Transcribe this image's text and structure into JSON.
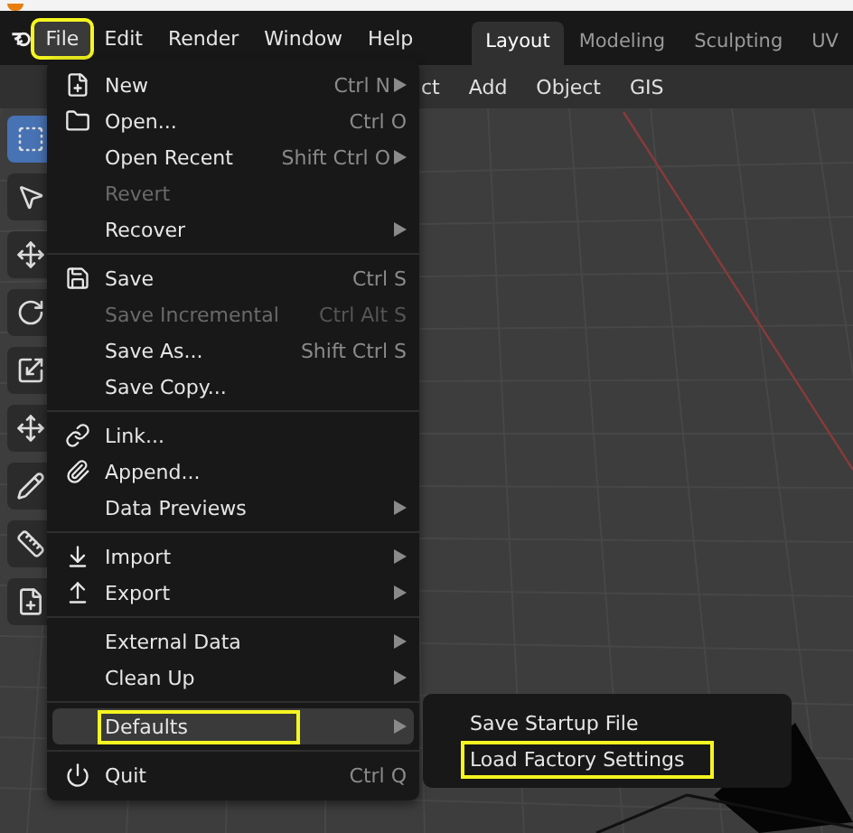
{
  "menubar": {
    "items": [
      {
        "label": "File",
        "selected": true,
        "annotated": true
      },
      {
        "label": "Edit",
        "selected": false,
        "annotated": false
      },
      {
        "label": "Render",
        "selected": false,
        "annotated": false
      },
      {
        "label": "Window",
        "selected": false,
        "annotated": false
      },
      {
        "label": "Help",
        "selected": false,
        "annotated": false
      }
    ]
  },
  "workspace_tabs": [
    {
      "label": "Layout",
      "selected": true
    },
    {
      "label": "Modeling",
      "selected": false
    },
    {
      "label": "Sculpting",
      "selected": false
    },
    {
      "label": "UV",
      "selected": false
    }
  ],
  "viewport_header": {
    "items": [
      "ct",
      "Add",
      "Object",
      "GIS"
    ]
  },
  "file_menu": {
    "sections": [
      [
        {
          "label": "New",
          "shortcut": "Ctrl N",
          "submenu": true,
          "disabled": false,
          "selected": false,
          "annotated": false
        },
        {
          "label": "Open...",
          "shortcut": "Ctrl O",
          "submenu": false,
          "disabled": false,
          "selected": false,
          "annotated": false
        },
        {
          "label": "Open Recent",
          "shortcut": "Shift Ctrl O",
          "submenu": true,
          "disabled": false,
          "selected": false,
          "annotated": false
        },
        {
          "label": "Revert",
          "submenu": false,
          "disabled": true,
          "selected": false,
          "annotated": false
        },
        {
          "label": "Recover",
          "submenu": true,
          "disabled": false,
          "selected": false,
          "annotated": false
        }
      ],
      [
        {
          "label": "Save",
          "shortcut": "Ctrl S",
          "submenu": false,
          "disabled": false,
          "selected": false,
          "annotated": false
        },
        {
          "label": "Save Incremental",
          "shortcut": "Ctrl Alt S",
          "submenu": false,
          "disabled": true,
          "selected": false,
          "annotated": false
        },
        {
          "label": "Save As...",
          "shortcut": "Shift Ctrl S",
          "submenu": false,
          "disabled": false,
          "selected": false,
          "annotated": false
        },
        {
          "label": "Save Copy...",
          "submenu": false,
          "disabled": false,
          "selected": false,
          "annotated": false
        }
      ],
      [
        {
          "label": "Link...",
          "submenu": false,
          "disabled": false,
          "selected": false,
          "annotated": false
        },
        {
          "label": "Append...",
          "submenu": false,
          "disabled": false,
          "selected": false,
          "annotated": false
        },
        {
          "label": "Data Previews",
          "submenu": true,
          "disabled": false,
          "selected": false,
          "annotated": false
        }
      ],
      [
        {
          "label": "Import",
          "submenu": true,
          "disabled": false,
          "selected": false,
          "annotated": false
        },
        {
          "label": "Export",
          "submenu": true,
          "disabled": false,
          "selected": false,
          "annotated": false
        }
      ],
      [
        {
          "label": "External Data",
          "submenu": true,
          "disabled": false,
          "selected": false,
          "annotated": false
        },
        {
          "label": "Clean Up",
          "submenu": true,
          "disabled": false,
          "selected": false,
          "annotated": false
        }
      ],
      [
        {
          "label": "Defaults",
          "submenu": true,
          "disabled": false,
          "selected": true,
          "annotated": true
        }
      ],
      [
        {
          "label": "Quit",
          "shortcut": "Ctrl Q",
          "submenu": false,
          "disabled": false,
          "selected": false,
          "annotated": false
        }
      ]
    ]
  },
  "defaults_submenu": {
    "items": [
      {
        "label": "Save Startup File",
        "annotated": false
      },
      {
        "label": "Load Factory Settings",
        "annotated": true
      }
    ]
  }
}
